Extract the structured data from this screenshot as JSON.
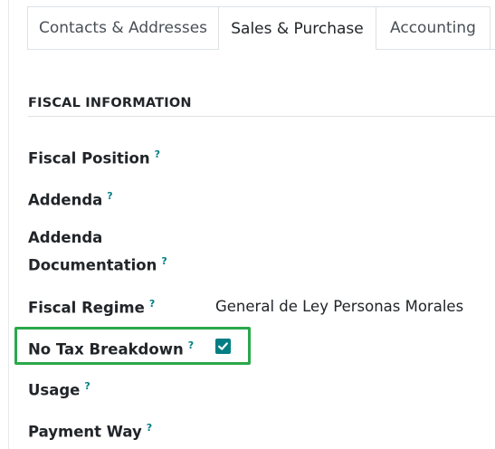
{
  "tabs": [
    {
      "label": "Contacts & Addresses",
      "active": false
    },
    {
      "label": "Sales & Purchase",
      "active": true
    },
    {
      "label": "Accounting",
      "active": false
    }
  ],
  "section": {
    "title": "FISCAL INFORMATION"
  },
  "fields": {
    "fiscal_position": {
      "label": "Fiscal Position",
      "help": "?",
      "value": ""
    },
    "addenda": {
      "label": "Addenda",
      "help": "?",
      "value": ""
    },
    "addenda_documentation": {
      "label_line1": "Addenda",
      "label_line2": "Documentation",
      "help": "?",
      "value": ""
    },
    "fiscal_regime": {
      "label": "Fiscal Regime",
      "help": "?",
      "value": "General de Ley Personas Morales"
    },
    "no_tax_breakdown": {
      "label": "No Tax Breakdown",
      "help": "?",
      "checked": true
    },
    "usage": {
      "label": "Usage",
      "help": "?",
      "value": ""
    },
    "payment_way": {
      "label": "Payment Way",
      "help": "?",
      "value": ""
    }
  },
  "colors": {
    "accent": "#017e84",
    "highlight": "#2aa84a"
  }
}
